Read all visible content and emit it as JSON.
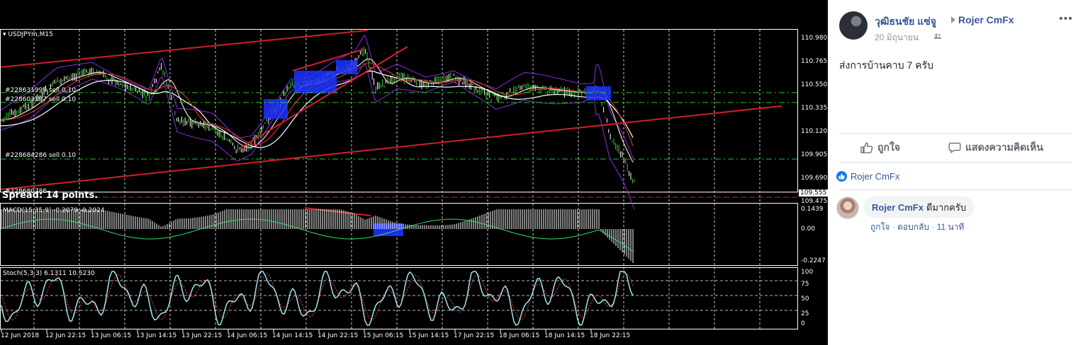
{
  "chart": {
    "symbol": "USDJPYm,M15",
    "orders": [
      "#228631999 sell 0.10",
      "#228603197 sell 0.10",
      "#228684286 sell 0.10",
      "#228680786"
    ],
    "spread": "Spread: 14 points.",
    "current_price": "109.555",
    "price_axis": [
      "110.980",
      "110.765",
      "110.550",
      "110.335",
      "110.120",
      "109.905",
      "109.690",
      "109.475"
    ],
    "macd": {
      "label": "MACD(15,35,9) -0.2079 -0.2024",
      "axis": [
        "0.1439",
        "0.00",
        "-0.2247"
      ]
    },
    "stoch": {
      "label": "Stoch(5,3,3) 6.1311 10.5230",
      "axis": [
        "100",
        "75",
        "50",
        "25",
        "0"
      ]
    },
    "time_axis": [
      "12 Jun 2018",
      "12 Jun 22:15",
      "13 Jun 06:15",
      "13 Jun 14:15",
      "13 Jun 22:15",
      "14 Jun 06:15",
      "14 Jun 14:15",
      "14 Jun 22:15",
      "15 Jun 06:15",
      "15 Jun 14:15",
      "17 Jun 22:15",
      "18 Jun 06:15",
      "18 Jun 14:15",
      "18 Jun 22:15"
    ],
    "colors": {
      "trendline": "#d0202a",
      "candle_up": "#2ecc2e",
      "level": "#22cc22",
      "zone": "#1e32ff",
      "bollinger": "#8a2be2"
    }
  },
  "post": {
    "author": "วุฒิธนชัย แซ่จู",
    "group": "Rojer CmFx",
    "date": "20 มิถุนายน",
    "more": "•••",
    "text": "ส่งการบ้านคาบ 7 ครับ",
    "like_label": "ถูกใจ",
    "comment_label": "แสดงความคิดเห็น",
    "likes_by": "Rojer CmFx",
    "comment": {
      "name": "Rojer CmFx",
      "text": "ดีมากครับ",
      "like": "ถูกใจ",
      "reply": "ตอบกลับ",
      "time": "11 นาที"
    }
  }
}
